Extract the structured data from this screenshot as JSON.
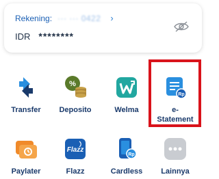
{
  "account": {
    "label": "Rekening:",
    "number": "··· ··· 0422",
    "currency": "IDR",
    "balance": "********"
  },
  "menu": [
    {
      "label": "Transfer",
      "icon": "transfer-icon"
    },
    {
      "label": "Deposito",
      "icon": "deposito-icon"
    },
    {
      "label": "Welma",
      "icon": "welma-icon"
    },
    {
      "label": "e-\nStatement",
      "icon": "e-statement-icon"
    },
    {
      "label": "Paylater",
      "icon": "paylater-icon"
    },
    {
      "label": "Flazz",
      "icon": "flazz-icon"
    },
    {
      "label": "Cardless",
      "icon": "cardless-icon"
    },
    {
      "label": "Lainnya",
      "icon": "more-icon"
    }
  ],
  "colors": {
    "primary": "#1a5fb4",
    "accent": "#2a8fdf",
    "highlight": "#d9131b"
  }
}
